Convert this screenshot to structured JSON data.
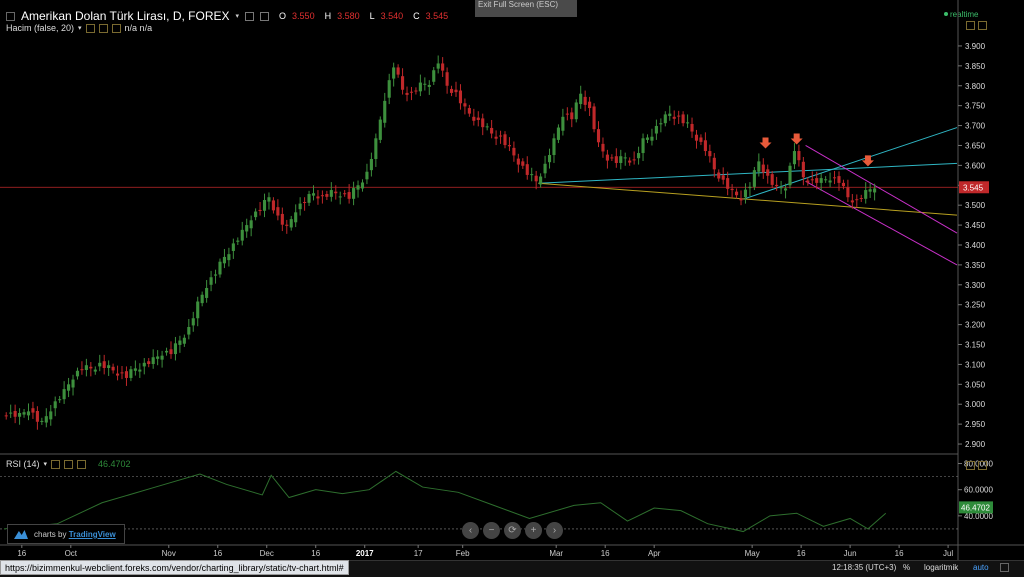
{
  "header": {
    "title": "Amerikan Dolan Türk Lirası, D, FOREX",
    "ohlc": [
      {
        "k": "O",
        "v": "3.550"
      },
      {
        "k": "H",
        "v": "3.580"
      },
      {
        "k": "L",
        "v": "3.540"
      },
      {
        "k": "C",
        "v": "3.545"
      }
    ],
    "volume_label": "Hacim (false, 20)",
    "volume_value": "n/a n/a",
    "exit_fullscreen": "Exit Full Screen (ESC)",
    "realtime": "realtime"
  },
  "rsi": {
    "label": "RSI (14)",
    "value": "46.4702",
    "current": 46.4702
  },
  "branding": {
    "prefix": "charts by",
    "name": "TradingView"
  },
  "status": {
    "url": "https://bizimmenkul-webclient.foreks.com/vendor/charting_library/static/tv-chart.html#",
    "time": "12:18:35 (UTC+3)",
    "percent": "%",
    "log": "logaritmik",
    "auto": "auto"
  },
  "colors": {
    "up": "#3d8f3d",
    "down": "#c0282a",
    "rsi": "#2e6f2e",
    "price_line": "#c0282a",
    "cyan": "#2fb6c4",
    "magenta": "#c830c8",
    "yellow": "#b8a020",
    "arrow": "#e85a3a"
  },
  "chart_data": {
    "type": "candlestick",
    "price_axis": {
      "ticks": [
        "3.900",
        "3.850",
        "3.800",
        "3.750",
        "3.700",
        "3.650",
        "3.600",
        "3.550",
        "3.500",
        "3.450",
        "3.400",
        "3.350",
        "3.300",
        "3.250",
        "3.200",
        "3.150",
        "3.100",
        "3.050",
        "3.000",
        "2.950",
        "2.900"
      ],
      "ylim": [
        2.88,
        3.93
      ]
    },
    "current_price": {
      "value": 3.545,
      "label": "3.545"
    },
    "rsi_axis": {
      "ticks": [
        "80.0000",
        "60.0000",
        "40.0000"
      ],
      "levels": [
        70,
        30
      ],
      "ylim": [
        20,
        85
      ]
    },
    "time_axis": {
      "labels": [
        "16",
        "Oct",
        "Nov",
        "16",
        "Dec",
        "16",
        "2017",
        "17",
        "Feb",
        "Mar",
        "16",
        "Apr",
        "May",
        "16",
        "Jun",
        "16",
        "Jul"
      ],
      "bold": "2017"
    },
    "x_range": [
      0,
      214
    ],
    "tick_positions": [
      4,
      15,
      37,
      48,
      59,
      70,
      81,
      93,
      103,
      124,
      135,
      146,
      168,
      179,
      190,
      201,
      212
    ],
    "series": [
      {
        "name": "price",
        "points": [
          [
            0,
            2.98
          ],
          [
            4,
            2.97
          ],
          [
            6,
            2.99
          ],
          [
            8,
            2.96
          ],
          [
            9,
            2.95
          ],
          [
            11,
            2.99
          ],
          [
            14,
            3.03
          ],
          [
            16,
            3.07
          ],
          [
            18,
            3.09
          ],
          [
            20,
            3.09
          ],
          [
            22,
            3.1
          ],
          [
            24,
            3.09
          ],
          [
            26,
            3.08
          ],
          [
            28,
            3.07
          ],
          [
            30,
            3.09
          ],
          [
            32,
            3.1
          ],
          [
            34,
            3.11
          ],
          [
            36,
            3.13
          ],
          [
            38,
            3.13
          ],
          [
            40,
            3.16
          ],
          [
            42,
            3.19
          ],
          [
            44,
            3.25
          ],
          [
            46,
            3.3
          ],
          [
            48,
            3.33
          ],
          [
            50,
            3.37
          ],
          [
            52,
            3.4
          ],
          [
            54,
            3.43
          ],
          [
            56,
            3.47
          ],
          [
            58,
            3.49
          ],
          [
            60,
            3.52
          ],
          [
            62,
            3.47
          ],
          [
            64,
            3.44
          ],
          [
            66,
            3.49
          ],
          [
            68,
            3.51
          ],
          [
            70,
            3.53
          ],
          [
            72,
            3.52
          ],
          [
            74,
            3.53
          ],
          [
            76,
            3.53
          ],
          [
            78,
            3.52
          ],
          [
            80,
            3.55
          ],
          [
            82,
            3.58
          ],
          [
            84,
            3.66
          ],
          [
            86,
            3.77
          ],
          [
            88,
            3.85
          ],
          [
            90,
            3.79
          ],
          [
            92,
            3.78
          ],
          [
            94,
            3.8
          ],
          [
            96,
            3.81
          ],
          [
            98,
            3.86
          ],
          [
            100,
            3.8
          ],
          [
            102,
            3.78
          ],
          [
            104,
            3.74
          ],
          [
            106,
            3.72
          ],
          [
            108,
            3.7
          ],
          [
            110,
            3.68
          ],
          [
            112,
            3.67
          ],
          [
            114,
            3.64
          ],
          [
            116,
            3.61
          ],
          [
            118,
            3.58
          ],
          [
            120,
            3.56
          ],
          [
            122,
            3.6
          ],
          [
            124,
            3.66
          ],
          [
            126,
            3.73
          ],
          [
            128,
            3.72
          ],
          [
            130,
            3.78
          ],
          [
            132,
            3.74
          ],
          [
            134,
            3.65
          ],
          [
            136,
            3.62
          ],
          [
            138,
            3.61
          ],
          [
            140,
            3.62
          ],
          [
            142,
            3.61
          ],
          [
            144,
            3.66
          ],
          [
            146,
            3.68
          ],
          [
            148,
            3.71
          ],
          [
            150,
            3.73
          ],
          [
            152,
            3.72
          ],
          [
            154,
            3.7
          ],
          [
            156,
            3.67
          ],
          [
            158,
            3.64
          ],
          [
            160,
            3.59
          ],
          [
            162,
            3.56
          ],
          [
            164,
            3.53
          ],
          [
            166,
            3.52
          ],
          [
            168,
            3.55
          ],
          [
            170,
            3.61
          ],
          [
            172,
            3.57
          ],
          [
            174,
            3.54
          ],
          [
            176,
            3.55
          ],
          [
            178,
            3.64
          ],
          [
            180,
            3.57
          ],
          [
            182,
            3.56
          ],
          [
            184,
            3.56
          ],
          [
            186,
            3.57
          ],
          [
            188,
            3.56
          ],
          [
            190,
            3.52
          ],
          [
            192,
            3.51
          ],
          [
            194,
            3.53
          ],
          [
            196,
            3.55
          ]
        ]
      },
      {
        "name": "rsi",
        "points": [
          [
            0,
            30
          ],
          [
            12,
            34
          ],
          [
            22,
            50
          ],
          [
            34,
            62
          ],
          [
            44,
            72
          ],
          [
            50,
            64
          ],
          [
            58,
            56
          ],
          [
            60,
            71
          ],
          [
            64,
            54
          ],
          [
            70,
            60
          ],
          [
            76,
            57
          ],
          [
            82,
            60
          ],
          [
            88,
            74
          ],
          [
            94,
            62
          ],
          [
            102,
            58
          ],
          [
            110,
            48
          ],
          [
            118,
            38
          ],
          [
            128,
            48
          ],
          [
            134,
            50
          ],
          [
            140,
            36
          ],
          [
            146,
            46
          ],
          [
            152,
            44
          ],
          [
            158,
            34
          ],
          [
            166,
            28
          ],
          [
            172,
            40
          ],
          [
            178,
            42
          ],
          [
            184,
            32
          ],
          [
            190,
            38
          ],
          [
            194,
            30
          ],
          [
            198,
            42
          ]
        ]
      }
    ],
    "trendlines": [
      {
        "color": "cyan",
        "from": [
          120,
          3.555
        ],
        "to": [
          214,
          3.605
        ]
      },
      {
        "color": "cyan",
        "from": [
          166,
          3.515
        ],
        "to": [
          214,
          3.695
        ]
      },
      {
        "color": "yellow",
        "from": [
          120,
          3.555
        ],
        "to": [
          214,
          3.475
        ]
      },
      {
        "color": "magenta",
        "from": [
          180,
          3.65
        ],
        "to": [
          214,
          3.43
        ]
      },
      {
        "color": "magenta",
        "from": [
          180,
          3.56
        ],
        "to": [
          214,
          3.35
        ]
      }
    ],
    "arrows": [
      [
        171,
        3.645
      ],
      [
        178,
        3.655
      ],
      [
        194,
        3.6
      ]
    ]
  }
}
